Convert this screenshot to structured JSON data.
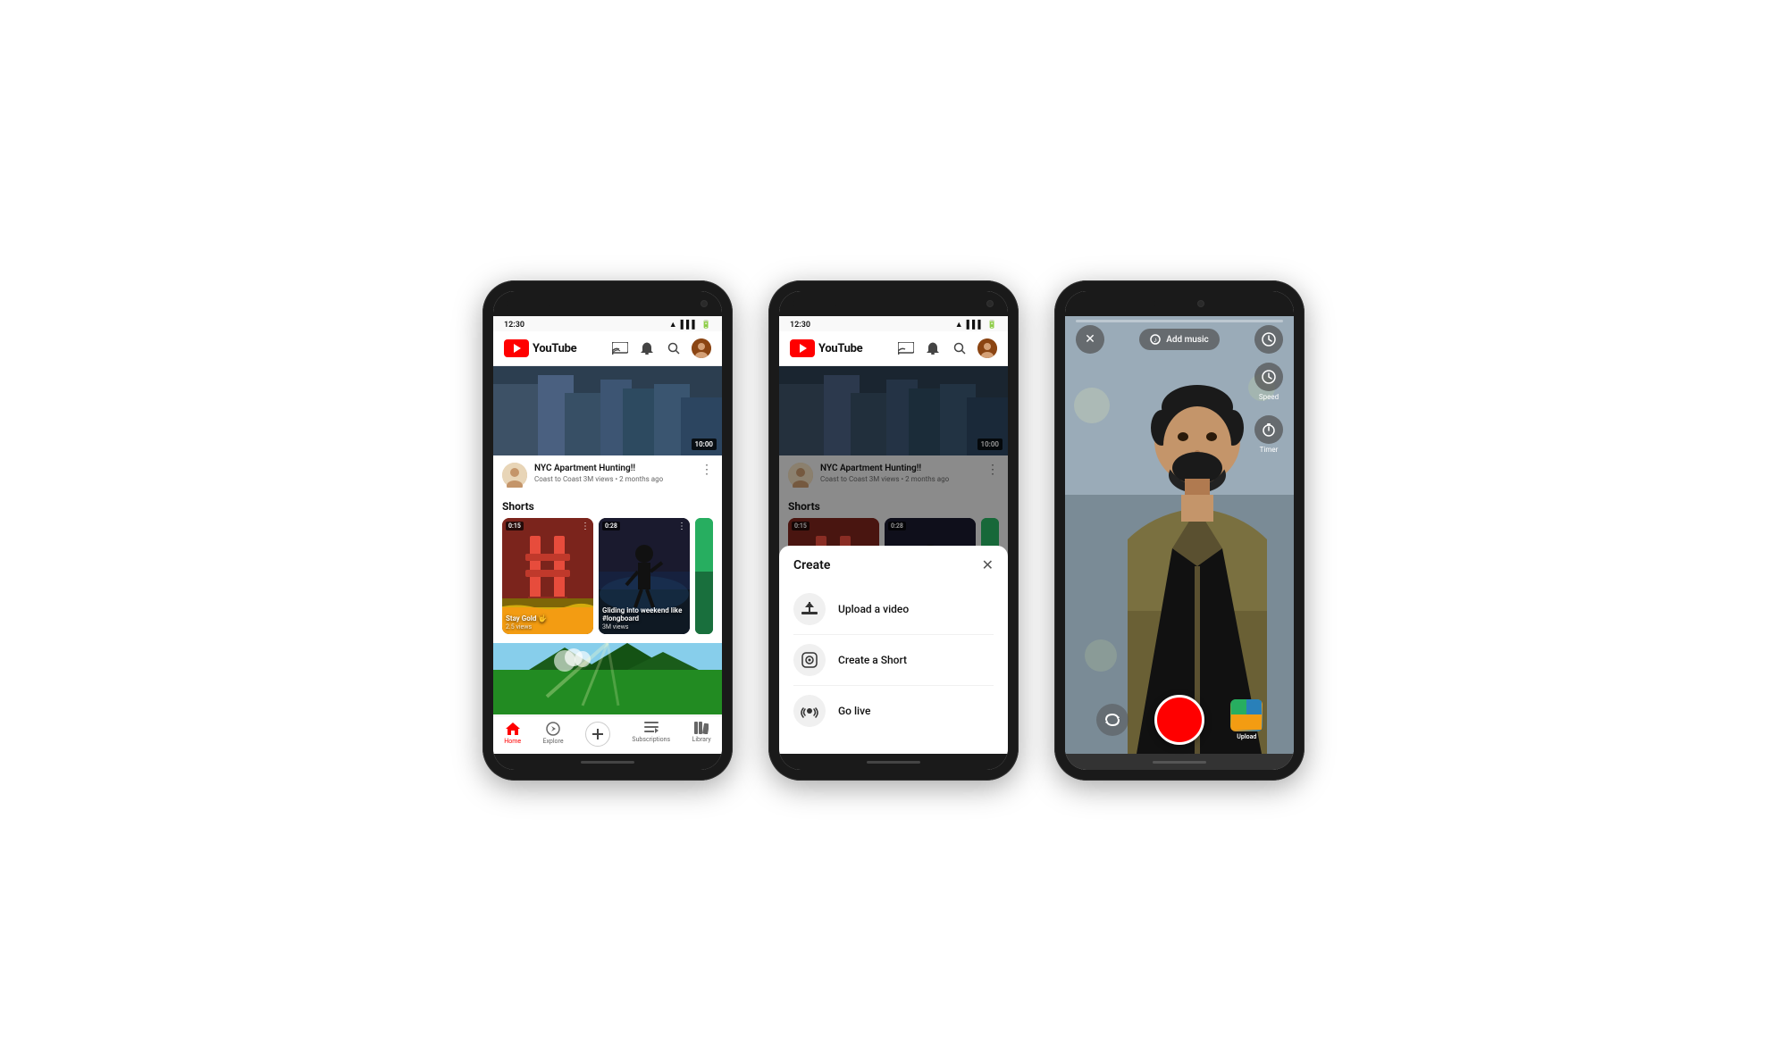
{
  "phone1": {
    "status_time": "12:30",
    "header": {
      "logo_text": "YouTube",
      "cast_icon": "📺",
      "bell_icon": "🔔",
      "search_icon": "🔍"
    },
    "featured_video": {
      "duration": "10:00",
      "title": "NYC Apartment Hunting!!",
      "channel": "Coast to Coast",
      "meta": "3M views • 2 months ago"
    },
    "shorts": {
      "section_label": "Shorts",
      "items": [
        {
          "duration": "0:15",
          "title": "Stay Gold 🤟",
          "views": "2.5 views",
          "color_top": "#c0392b",
          "color_bottom": "#f39c12"
        },
        {
          "duration": "0:28",
          "title": "Gliding into weekend like #longboard",
          "views": "3M views",
          "color_top": "#1a1a2e",
          "color_bottom": "#533483"
        }
      ]
    },
    "bottom_nav": {
      "items": [
        {
          "label": "Home",
          "icon": "🏠",
          "active": true
        },
        {
          "label": "Explore",
          "icon": "🧭",
          "active": false
        },
        {
          "label": "",
          "icon": "+",
          "active": false
        },
        {
          "label": "Subscriptions",
          "icon": "≡",
          "active": false
        },
        {
          "label": "Library",
          "icon": "📚",
          "active": false
        }
      ]
    }
  },
  "phone2": {
    "status_time": "12:30",
    "header": {
      "logo_text": "YouTube"
    },
    "featured_video": {
      "duration": "10:00",
      "title": "NYC Apartment Hunting!!",
      "channel": "Coast to Coast",
      "meta": "3M views • 2 months ago"
    },
    "shorts": {
      "section_label": "Shorts"
    },
    "create_modal": {
      "title": "Create",
      "close_label": "✕",
      "items": [
        {
          "icon": "⬆",
          "label": "Upload a video"
        },
        {
          "icon": "📷",
          "label": "Create a Short"
        },
        {
          "icon": "📡",
          "label": "Go live"
        }
      ]
    }
  },
  "phone3": {
    "add_music_label": "Add music",
    "speed_label": "Speed",
    "timer_label": "Timer",
    "upload_label": "Upload",
    "controls": {
      "close_icon": "✕",
      "music_icon": "🎵",
      "speed_icon": "⏱",
      "timer_icon": "⏰",
      "flip_icon": "↺"
    }
  }
}
